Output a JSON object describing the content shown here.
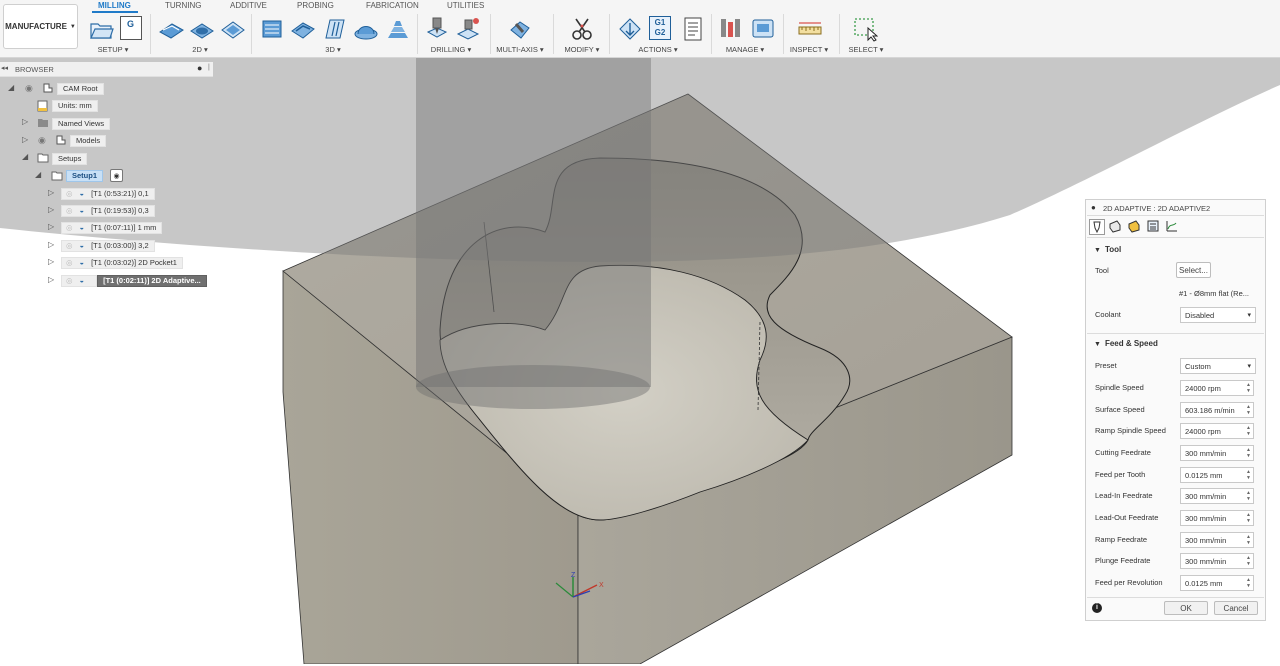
{
  "toolbar": {
    "manufacture_label": "MANUFACTURE",
    "tabs": [
      "MILLING",
      "TURNING",
      "ADDITIVE",
      "PROBING",
      "FABRICATION",
      "UTILITIES"
    ],
    "groups": [
      "SETUP",
      "2D",
      "3D",
      "DRILLING",
      "MULTI-AXIS",
      "MODIFY",
      "ACTIONS",
      "MANAGE",
      "INSPECT",
      "SELECT"
    ],
    "g1g2_icon_text": [
      "G1",
      "G2"
    ],
    "setup_icon_text": "G",
    "accent": "#1f7ac8"
  },
  "browser": {
    "title": "BROWSER",
    "root": "CAM Root",
    "units": "Units: mm",
    "named_views": "Named Views",
    "models": "Models",
    "setups": "Setups",
    "setup1": "Setup1",
    "operations": [
      "[T1 (0:53:21)] 0,1",
      "[T1 (0:19:53)] 0,3",
      "[T1 (0:07:11)] 1 mm",
      "[T1 (0:03:00)] 3,2",
      "[T1 (0:03:02)] 2D Pocket1",
      "[T1 (0:02:11)] 2D Adaptive..."
    ]
  },
  "dialog": {
    "title": "2D ADAPTIVE : 2D ADAPTIVE2",
    "tool_section": "Tool",
    "tool_label": "Tool",
    "select_button": "Select...",
    "tool_desc": "#1 - Ø8mm flat (Re...",
    "coolant_label": "Coolant",
    "coolant_value": "Disabled",
    "feed_section": "Feed & Speed",
    "preset_label": "Preset",
    "preset_value": "Custom",
    "fields": [
      {
        "label": "Spindle Speed",
        "value": "24000 rpm"
      },
      {
        "label": "Surface Speed",
        "value": "603.186 m/min"
      },
      {
        "label": "Ramp Spindle Speed",
        "value": "24000 rpm"
      },
      {
        "label": "Cutting Feedrate",
        "value": "300 mm/min"
      },
      {
        "label": "Feed per Tooth",
        "value": "0.0125 mm"
      },
      {
        "label": "Lead-In Feedrate",
        "value": "300 mm/min"
      },
      {
        "label": "Lead-Out Feedrate",
        "value": "300 mm/min"
      },
      {
        "label": "Ramp Feedrate",
        "value": "300 mm/min"
      },
      {
        "label": "Plunge Feedrate",
        "value": "300 mm/min"
      },
      {
        "label": "Feed per Revolution",
        "value": "0.0125 mm"
      }
    ],
    "ok": "OK",
    "cancel": "Cancel"
  },
  "axes": {
    "z": "Z",
    "x": "X"
  }
}
